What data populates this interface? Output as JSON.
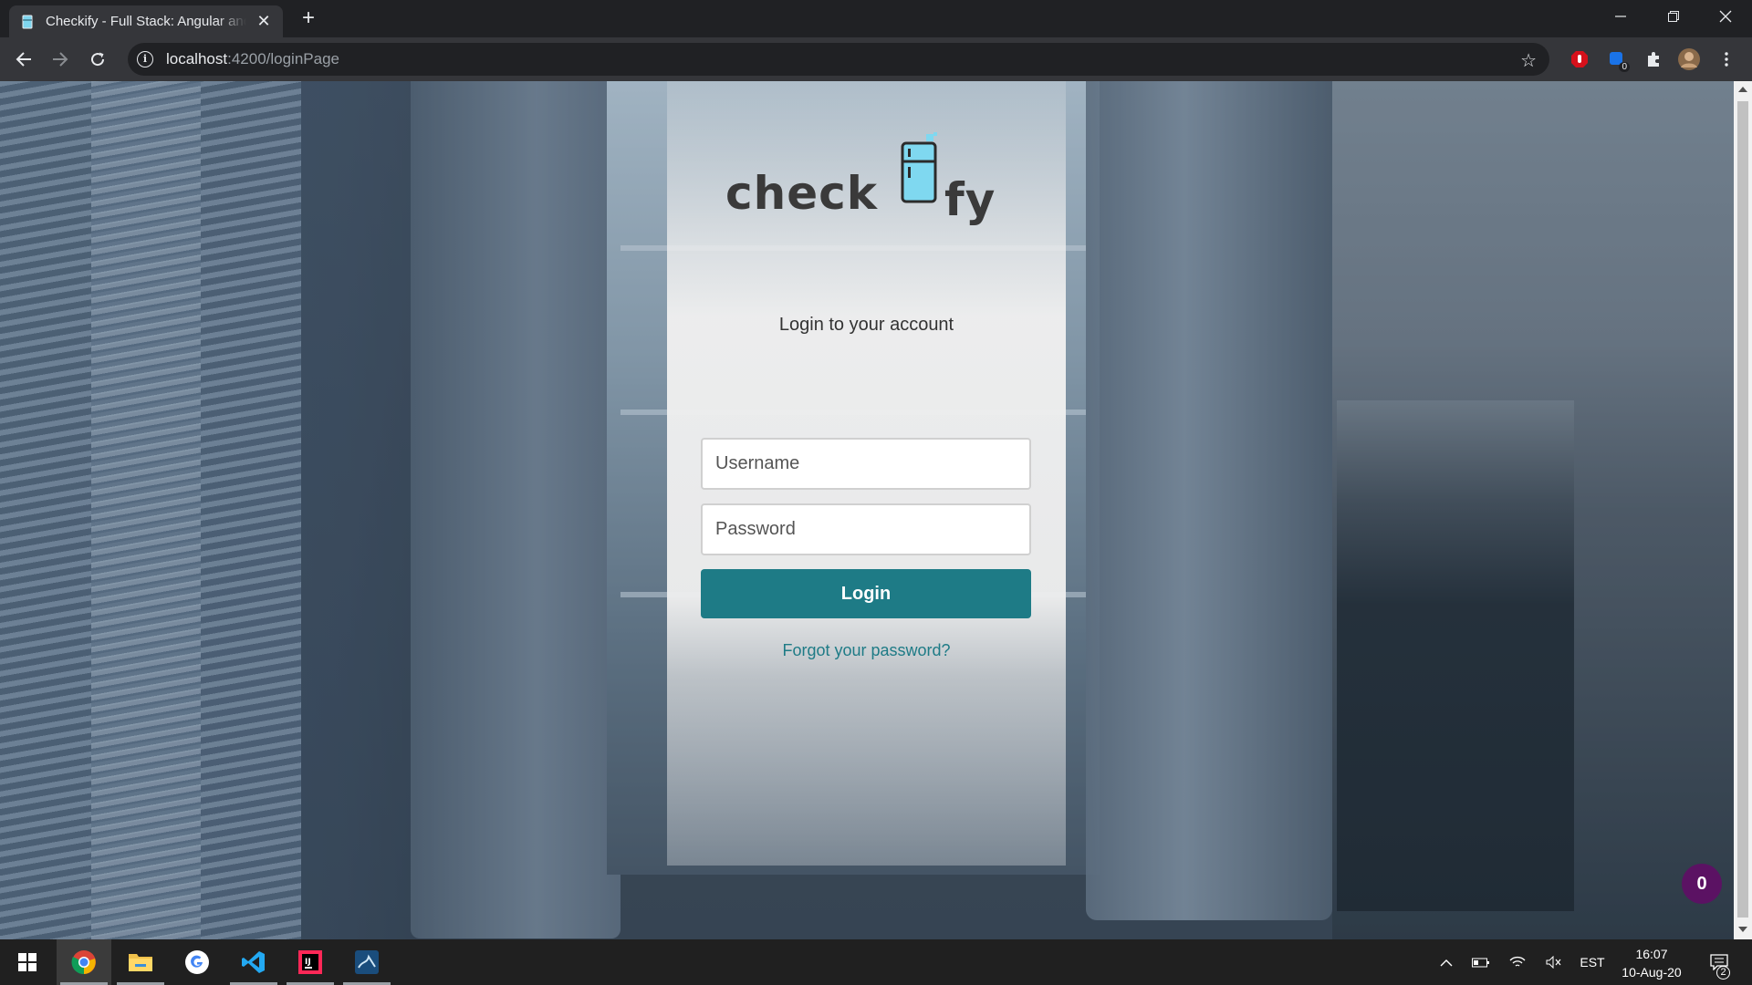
{
  "browser": {
    "tab_title": "Checkify - Full Stack: Angular and",
    "url_host": "localhost",
    "url_path": ":4200/loginPage"
  },
  "extensions": {
    "badge_count": "0"
  },
  "login": {
    "heading": "Login to your account",
    "username_placeholder": "Username",
    "password_placeholder": "Password",
    "login_label": "Login",
    "forgot_label": "Forgot your password?"
  },
  "logo": {
    "left_text": "check",
    "right_text": "fy"
  },
  "fab": {
    "count": "0"
  },
  "taskbar": {
    "language": "EST",
    "time": "16:07",
    "date": "10-Aug-20",
    "notifications": "2"
  },
  "colors": {
    "accent": "#1e7b86",
    "fab": "#5b1263"
  }
}
